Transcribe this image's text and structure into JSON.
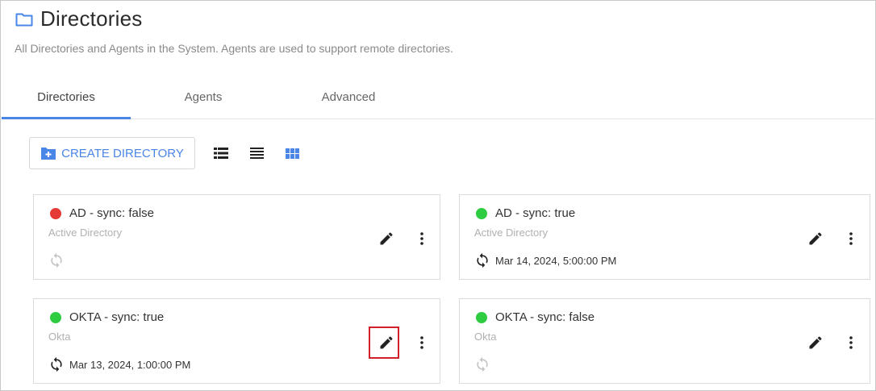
{
  "header": {
    "title": "Directories",
    "subtitle": "All Directories and Agents in the System. Agents are used to support remote directories."
  },
  "tabs": [
    {
      "label": "Directories",
      "active": true
    },
    {
      "label": "Agents",
      "active": false
    },
    {
      "label": "Advanced",
      "active": false
    }
  ],
  "toolbar": {
    "create_label": "CREATE DIRECTORY",
    "view_modes": [
      "list-view-icon",
      "compact-list-icon",
      "grid-view-icon"
    ],
    "active_view": "grid-view-icon"
  },
  "colors": {
    "accent": "#4a86e8",
    "status_red": "#e53935",
    "status_green": "#2ecc40",
    "highlight": "#d0202a"
  },
  "directories": [
    {
      "title": "AD - sync: false",
      "type": "Active Directory",
      "status": "red",
      "last_sync": ""
    },
    {
      "title": "AD - sync: true",
      "type": "Active Directory",
      "status": "green",
      "last_sync": "Mar 14, 2024, 5:00:00 PM"
    },
    {
      "title": "OKTA - sync: true",
      "type": "Okta",
      "status": "green",
      "last_sync": "Mar 13, 2024, 1:00:00 PM"
    },
    {
      "title": "OKTA - sync: false",
      "type": "Okta",
      "status": "green",
      "last_sync": ""
    }
  ]
}
